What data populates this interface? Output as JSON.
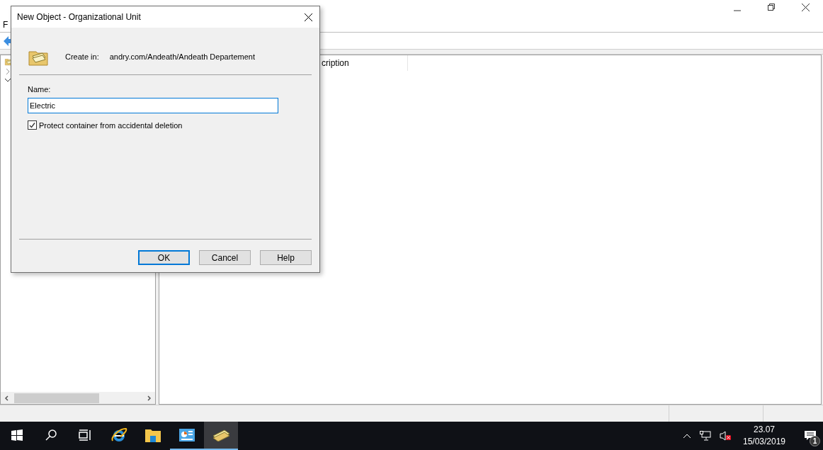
{
  "background_window": {
    "menu_visible": "F",
    "list_columns": [
      "cription"
    ]
  },
  "dialog": {
    "title": "New Object - Organizational Unit",
    "create_in_label": "Create in:",
    "create_in_path": "andry.com/Andeath/Andeath Departement",
    "name_label": "Name:",
    "name_value": "Electric",
    "protect": {
      "label": "Protect container from accidental deletion",
      "checked": true
    },
    "buttons": [
      {
        "label": "OK",
        "default": true
      },
      {
        "label": "Cancel",
        "default": false
      },
      {
        "label": "Help",
        "default": false
      }
    ]
  },
  "taskbar": {
    "apps": [
      {
        "kind": "start",
        "running": false,
        "selected": false
      },
      {
        "kind": "search",
        "running": false,
        "selected": false
      },
      {
        "kind": "taskview",
        "running": false,
        "selected": false
      },
      {
        "kind": "browser",
        "running": false,
        "selected": false
      },
      {
        "kind": "folder",
        "running": false,
        "selected": false
      },
      {
        "kind": "dashboard",
        "running": true,
        "selected": false
      },
      {
        "kind": "directory",
        "running": true,
        "selected": true
      }
    ],
    "time": "23.07",
    "date": "15/03/2019",
    "notification_count": "1"
  }
}
